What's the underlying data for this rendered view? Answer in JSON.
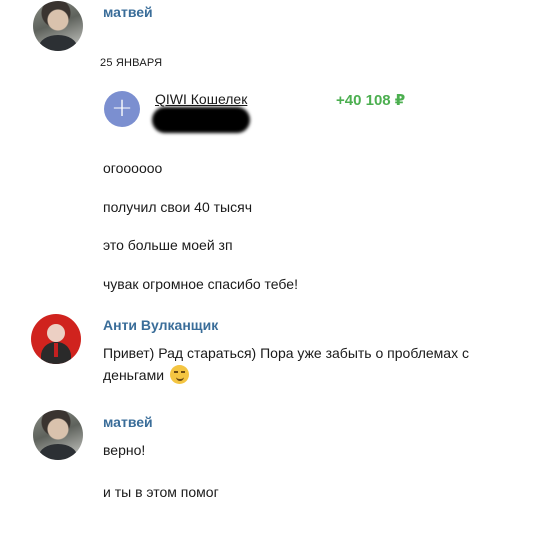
{
  "messages": {
    "group1": {
      "sender": "матвей",
      "date": "25 ЯНВАРЯ",
      "transfer": {
        "wallet": "QIWI Кошелек",
        "amount": "+40 108 ₽"
      },
      "lines": [
        "огоооооо",
        "получил свои 40 тысяч",
        "это больше моей зп",
        "чувак огромное спасибо тебе!"
      ]
    },
    "group2": {
      "sender": "Анти Вулканщик",
      "text_line1": "Привет) Рад стараться) Пора уже забыть о проблемах с",
      "text_line2": "деньгами"
    },
    "group3": {
      "sender": "матвей",
      "lines": [
        "верно!",
        "и ты в этом помог"
      ]
    }
  },
  "icons": {
    "transfer": "plus-icon",
    "emoji": "smirk-emoji-icon"
  },
  "colors": {
    "sender_name": "#3a6d99",
    "amount": "#4caf50",
    "plus_circle": "#7b8fd0",
    "anti_avatar": "#d0231e"
  }
}
